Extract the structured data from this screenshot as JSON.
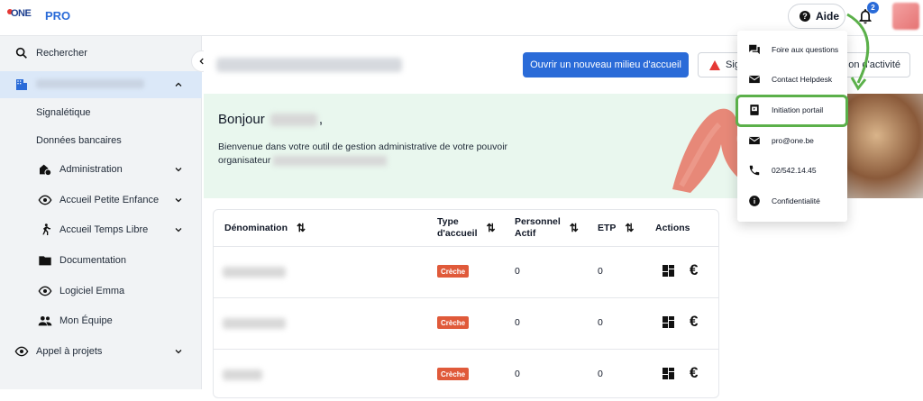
{
  "brand": {
    "logo_text": "ONE",
    "product": "PRO"
  },
  "topbar": {
    "help_label": "Aide",
    "notifications_count": "2"
  },
  "sidebar": {
    "search_label": "Rechercher",
    "sub_items": [
      "Signalétique",
      "Données bancaires"
    ],
    "items": [
      {
        "label": "Administration",
        "icon": "building-shield-icon"
      },
      {
        "label": "Accueil Petite Enfance",
        "icon": "eye-icon"
      },
      {
        "label": "Accueil Temps Libre",
        "icon": "running-icon"
      },
      {
        "label": "Documentation",
        "icon": "folder-icon"
      },
      {
        "label": "Logiciel Emma",
        "icon": "eye-icon"
      },
      {
        "label": "Mon Équipe",
        "icon": "people-icon"
      }
    ],
    "projects_label": "Appel à projets"
  },
  "header": {
    "new_place_button": "Ouvrir un nouveau milieu d'accueil",
    "report_button_left": "Sig",
    "report_button_right": "on d'activité"
  },
  "hero": {
    "greeting": "Bonjour",
    "greeting_suffix": ",",
    "welcome_line": "Bienvenue dans votre outil de gestion administrative de votre pouvoir organisateur"
  },
  "table": {
    "columns": [
      "Dénomination",
      "Type d'accueil",
      "Personnel Actif",
      "ETP",
      "Actions"
    ],
    "rows": [
      {
        "type": "Crèche",
        "personnel": "0",
        "etp": "0"
      },
      {
        "type": "Crèche",
        "personnel": "0",
        "etp": "0"
      },
      {
        "type": "Crèche",
        "personnel": "0",
        "etp": "0"
      }
    ]
  },
  "help_menu": {
    "items": [
      {
        "label": "Foire aux questions",
        "icon": "chat-icon"
      },
      {
        "label": "Contact Helpdesk",
        "icon": "mail-icon"
      },
      {
        "label": "Initiation portail",
        "icon": "tutorial-icon"
      },
      {
        "label": "pro@one.be",
        "icon": "mail-icon"
      },
      {
        "label": "02/542.14.45",
        "icon": "phone-icon"
      },
      {
        "label": "Confidentialité",
        "icon": "info-icon"
      }
    ]
  },
  "colors": {
    "primary": "#2a6bd8",
    "highlight": "#5bb04a",
    "badge": "#e05a3a",
    "hero_bg": "#e9f7ee"
  }
}
